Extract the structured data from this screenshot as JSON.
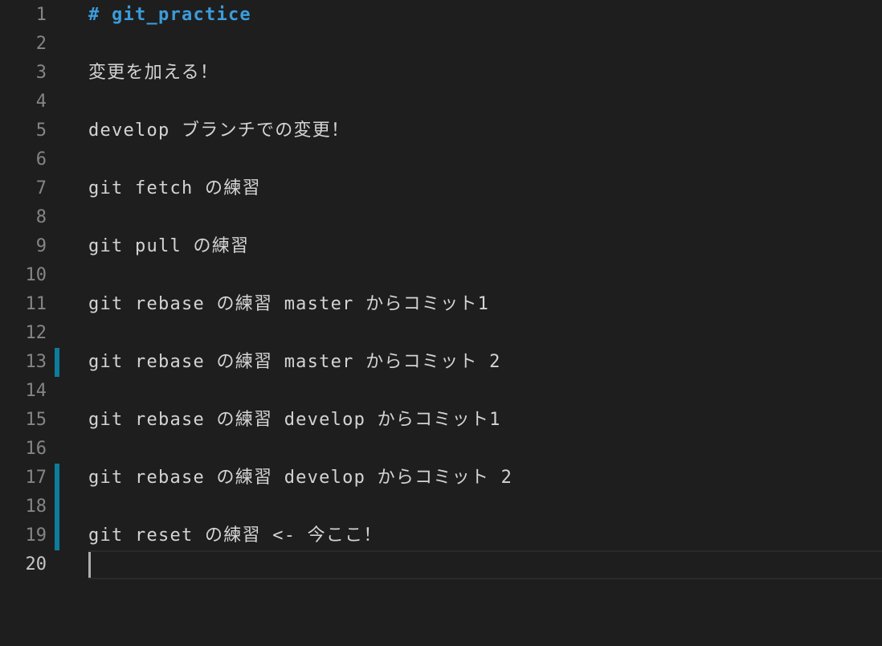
{
  "editor": {
    "lines": [
      {
        "number": "1",
        "text": "# git_practice",
        "heading": true,
        "modified": false
      },
      {
        "number": "2",
        "text": "",
        "modified": false
      },
      {
        "number": "3",
        "text": "変更を加える！",
        "modified": false
      },
      {
        "number": "4",
        "text": "",
        "modified": false
      },
      {
        "number": "5",
        "text": "develop ブランチでの変更！",
        "modified": false
      },
      {
        "number": "6",
        "text": "",
        "modified": false
      },
      {
        "number": "7",
        "text": "git fetch の練習",
        "modified": false
      },
      {
        "number": "8",
        "text": "",
        "modified": false
      },
      {
        "number": "9",
        "text": "git pull の練習",
        "modified": false
      },
      {
        "number": "10",
        "text": "",
        "modified": false
      },
      {
        "number": "11",
        "text": "git rebase の練習 master からコミット1",
        "modified": false
      },
      {
        "number": "12",
        "text": "",
        "modified": false
      },
      {
        "number": "13",
        "text": "git rebase の練習 master からコミット 2",
        "modified": true
      },
      {
        "number": "14",
        "text": "",
        "modified": false
      },
      {
        "number": "15",
        "text": "git rebase の練習 develop からコミット1",
        "modified": false
      },
      {
        "number": "16",
        "text": "",
        "modified": false
      },
      {
        "number": "17",
        "text": "git rebase の練習 develop からコミット 2",
        "modified": true
      },
      {
        "number": "18",
        "text": "",
        "modified": true
      },
      {
        "number": "19",
        "text": "git reset の練習 <- 今ここ！",
        "modified": true
      },
      {
        "number": "20",
        "text": "",
        "modified": false,
        "active": true
      }
    ],
    "colors": {
      "heading": "#3b9cdb",
      "text": "#d4d4d4",
      "modified_marker": "#0c7d9d",
      "background": "#1e1e1e"
    }
  }
}
